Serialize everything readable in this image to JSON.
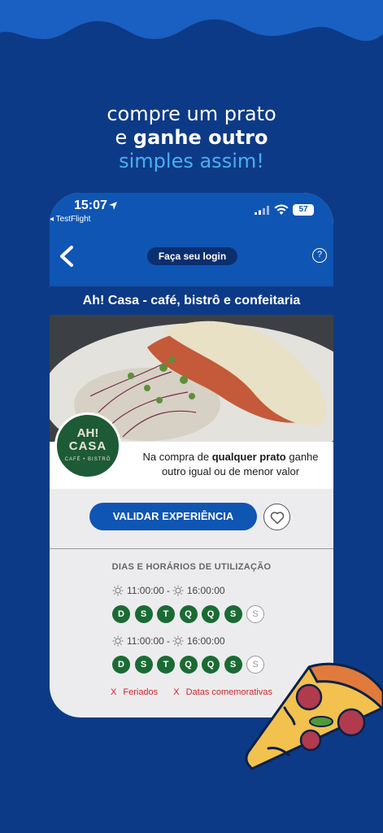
{
  "promo": {
    "line1": "compre um prato",
    "line2_pre": "e ",
    "line2_bold": "ganhe outro",
    "line3": "simples assim!"
  },
  "status_bar": {
    "time": "15:07",
    "back_app": "◂ TestFlight",
    "battery": "57"
  },
  "header": {
    "login_label": "Faça seu login",
    "help_label": "?"
  },
  "restaurant": {
    "title": "Ah! Casa - café, bistrô e confeitaria",
    "logo_line1": "AH!",
    "logo_line2": "CASA",
    "logo_line3": "CAFÉ • BISTRÔ"
  },
  "offer": {
    "text_pre": "Na compra de ",
    "text_bold": "qualquer prato",
    "text_post": " ganhe outro igual ou de menor valor"
  },
  "actions": {
    "validate_label": "VALIDAR EXPERIÊNCIA"
  },
  "schedule": {
    "title": "DIAS E HORÁRIOS DE UTILIZAÇÃO",
    "blocks": [
      {
        "start": "11:00:00",
        "end": "16:00:00",
        "days": [
          "D",
          "S",
          "T",
          "Q",
          "Q",
          "S",
          "S"
        ],
        "active": [
          true,
          true,
          true,
          true,
          true,
          true,
          false
        ]
      },
      {
        "start": "11:00:00",
        "end": "16:00:00",
        "days": [
          "D",
          "S",
          "T",
          "Q",
          "Q",
          "S",
          "S"
        ],
        "active": [
          true,
          true,
          true,
          true,
          true,
          true,
          false
        ]
      }
    ]
  },
  "exclusions": {
    "mark": "X",
    "items": [
      "Feriados",
      "Datas comemorativas"
    ]
  },
  "colors": {
    "background": "#0d3a86",
    "wave": "#1a5fc2",
    "accent_blue": "#0f55b3",
    "day_green": "#1a6b33",
    "exclusion_red": "#d0262b"
  }
}
